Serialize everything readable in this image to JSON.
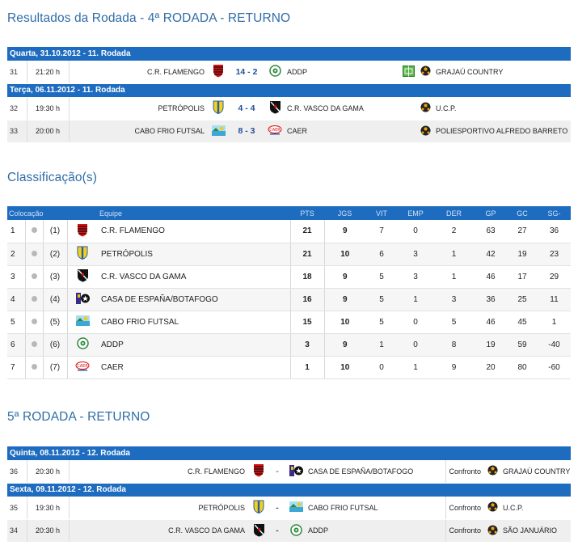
{
  "round4": {
    "title": "Resultados da Rodada - 4ª RODADA - RETURNO",
    "days": [
      {
        "label": "Quarta, 31.10.2012 - 11. Rodada",
        "games": [
          {
            "num": "31",
            "time": "21:20 h",
            "home": "C.R. FLAMENGO",
            "home_icon": "flamengo-crest-icon",
            "score": "14 - 2",
            "away": "ADDP",
            "away_icon": "addp-crest-icon",
            "extra_icon": "court-icon",
            "venue_icon": "ball-icon",
            "venue": "GRAJAÚ COUNTRY"
          }
        ]
      },
      {
        "label": "Terça, 06.11.2012 - 11. Rodada",
        "games": [
          {
            "num": "32",
            "time": "19:30 h",
            "home": "PETRÓPOLIS",
            "home_icon": "petropolis-crest-icon",
            "score": "4 - 4",
            "away": "C.R. VASCO DA GAMA",
            "away_icon": "vasco-crest-icon",
            "venue_icon": "ball-icon",
            "venue": "U.C.P."
          },
          {
            "num": "33",
            "time": "20:00 h",
            "home": "CABO FRIO FUTSAL",
            "home_icon": "cabofrio-crest-icon",
            "score": "8 - 3",
            "away": "CAER",
            "away_icon": "caer-crest-icon",
            "venue_icon": "ball-icon",
            "venue": "POLIESPORTIVO ALFREDO BARRETO"
          }
        ]
      }
    ]
  },
  "classification": {
    "title": "Classificação(s)",
    "headers": {
      "pos": "Colocação",
      "team": "Equipe",
      "pts": "PTS",
      "jgs": "JGS",
      "vit": "VIT",
      "emp": "EMP",
      "der": "DER",
      "gp": "GP",
      "gc": "GC",
      "sg": "SG-"
    },
    "rows": [
      {
        "pos": "1",
        "prev": "(1)",
        "team": "C.R. FLAMENGO",
        "icon": "flamengo-crest-icon",
        "pts": "21",
        "jgs": "9",
        "vit": "7",
        "emp": "0",
        "der": "2",
        "gp": "63",
        "gc": "27",
        "sg": "36"
      },
      {
        "pos": "2",
        "prev": "(2)",
        "team": "PETRÓPOLIS",
        "icon": "petropolis-crest-icon",
        "pts": "21",
        "jgs": "10",
        "vit": "6",
        "emp": "3",
        "der": "1",
        "gp": "42",
        "gc": "19",
        "sg": "23"
      },
      {
        "pos": "3",
        "prev": "(3)",
        "team": "C.R. VASCO DA GAMA",
        "icon": "vasco-crest-icon",
        "pts": "18",
        "jgs": "9",
        "vit": "5",
        "emp": "3",
        "der": "1",
        "gp": "46",
        "gc": "17",
        "sg": "29"
      },
      {
        "pos": "4",
        "prev": "(4)",
        "team": "CASA DE ESPAÑA/BOTAFOGO",
        "icon": "botafogo-crest-icon",
        "pts": "16",
        "jgs": "9",
        "vit": "5",
        "emp": "1",
        "der": "3",
        "gp": "36",
        "gc": "25",
        "sg": "11"
      },
      {
        "pos": "5",
        "prev": "(5)",
        "team": "CABO FRIO FUTSAL",
        "icon": "cabofrio-crest-icon",
        "pts": "15",
        "jgs": "10",
        "vit": "5",
        "emp": "0",
        "der": "5",
        "gp": "46",
        "gc": "45",
        "sg": "1"
      },
      {
        "pos": "6",
        "prev": "(6)",
        "team": "ADDP",
        "icon": "addp-crest-icon",
        "pts": "3",
        "jgs": "9",
        "vit": "1",
        "emp": "0",
        "der": "8",
        "gp": "19",
        "gc": "59",
        "sg": "-40"
      },
      {
        "pos": "7",
        "prev": "(7)",
        "team": "CAER",
        "icon": "caer-crest-icon",
        "pts": "1",
        "jgs": "10",
        "vit": "0",
        "emp": "1",
        "der": "9",
        "gp": "20",
        "gc": "80",
        "sg": "-60"
      }
    ]
  },
  "round5": {
    "title": "5ª RODADA - RETURNO",
    "days": [
      {
        "label": "Quinta, 08.11.2012 - 12. Rodada",
        "games": [
          {
            "num": "36",
            "time": "20:30 h",
            "home": "C.R. FLAMENGO",
            "home_icon": "flamengo-crest-icon",
            "score": "-",
            "away": "CASA DE ESPAÑA/BOTAFOGO",
            "away_icon": "botafogo-crest-icon",
            "confronto": "Confronto",
            "venue_icon": "ball-icon",
            "venue": "GRAJAÚ COUNTRY"
          }
        ]
      },
      {
        "label": "Sexta, 09.11.2012 - 12. Rodada",
        "games": [
          {
            "num": "35",
            "time": "19:30 h",
            "home": "PETRÓPOLIS",
            "home_icon": "petropolis-crest-icon",
            "score": "-",
            "away": "CABO FRIO FUTSAL",
            "away_icon": "cabofrio-crest-icon",
            "confronto": "Confronto",
            "venue_icon": "ball-icon",
            "venue": "U.C.P."
          },
          {
            "num": "34",
            "time": "20:30 h",
            "home": "C.R. VASCO DA GAMA",
            "home_icon": "vasco-crest-icon",
            "score": "-",
            "away": "ADDP",
            "away_icon": "addp-crest-icon",
            "confronto": "Confronto",
            "venue_icon": "ball-icon",
            "venue": "SÃO JANUÁRIO"
          }
        ]
      }
    ]
  }
}
